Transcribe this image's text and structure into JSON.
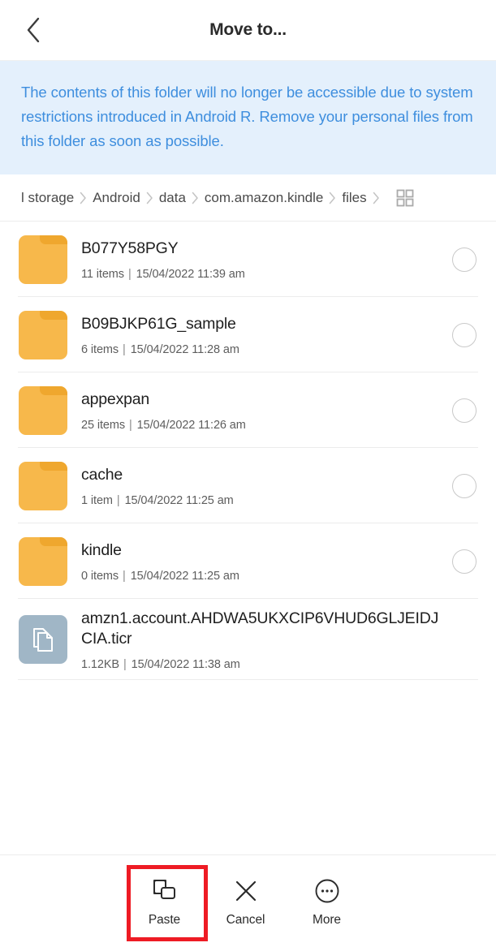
{
  "header": {
    "back_icon": "chevron-left-icon",
    "title": "Move to..."
  },
  "notice": {
    "text": "The contents of this folder will no longer be accessible due to system restrictions introduced in Android R. Remove your personal files from this folder as soon as possible.",
    "bg_color": "#e4f0fc",
    "text_color": "#3e8ede"
  },
  "breadcrumb": {
    "crumbs": [
      {
        "label": "l storage"
      },
      {
        "label": "Android"
      },
      {
        "label": "data"
      },
      {
        "label": "com.amazon.kindle"
      },
      {
        "label": "files"
      }
    ],
    "trailing_separator": true,
    "view_toggle_icon": "grid-view-icon"
  },
  "file_list": {
    "rows": [
      {
        "name": "B077Y58PGY",
        "type": "folder",
        "icon": "folder-icon",
        "count": "11 items",
        "separator": "|",
        "date": "15/04/2022 11:39 am",
        "selectable": true,
        "selected": false
      },
      {
        "name": "B09BJKP61G_sample",
        "type": "folder",
        "icon": "folder-icon",
        "count": "6 items",
        "separator": "|",
        "date": "15/04/2022 11:28 am",
        "selectable": true,
        "selected": false
      },
      {
        "name": "appexpan",
        "type": "folder",
        "icon": "folder-icon",
        "count": "25 items",
        "separator": "|",
        "date": "15/04/2022 11:26 am",
        "selectable": true,
        "selected": false
      },
      {
        "name": "cache",
        "type": "folder",
        "icon": "folder-icon",
        "count": "1 item",
        "separator": "|",
        "date": "15/04/2022 11:25 am",
        "selectable": true,
        "selected": false
      },
      {
        "name": "kindle",
        "type": "folder",
        "icon": "folder-icon",
        "count": "0 items",
        "separator": "|",
        "date": "15/04/2022 11:25 am",
        "selectable": true,
        "selected": false
      },
      {
        "name": "amzn1.account.AHDWA5UKXCIP6VHUD6GLJEIDJCIA.ticr",
        "type": "file",
        "icon": "document-icon",
        "count": "1.12KB",
        "separator": "|",
        "date": "15/04/2022 11:38 am",
        "selectable": false,
        "selected": false
      }
    ],
    "folder_color": "#f7b84b",
    "file_icon_color": "#a0b6c6"
  },
  "bottom_bar": {
    "buttons": [
      {
        "label": "Paste",
        "icon": "paste-icon",
        "highlighted": true
      },
      {
        "label": "Cancel",
        "icon": "close-icon",
        "highlighted": false
      },
      {
        "label": "More",
        "icon": "more-circle-icon",
        "highlighted": false
      }
    ],
    "highlight_color": "#ee1b24"
  }
}
